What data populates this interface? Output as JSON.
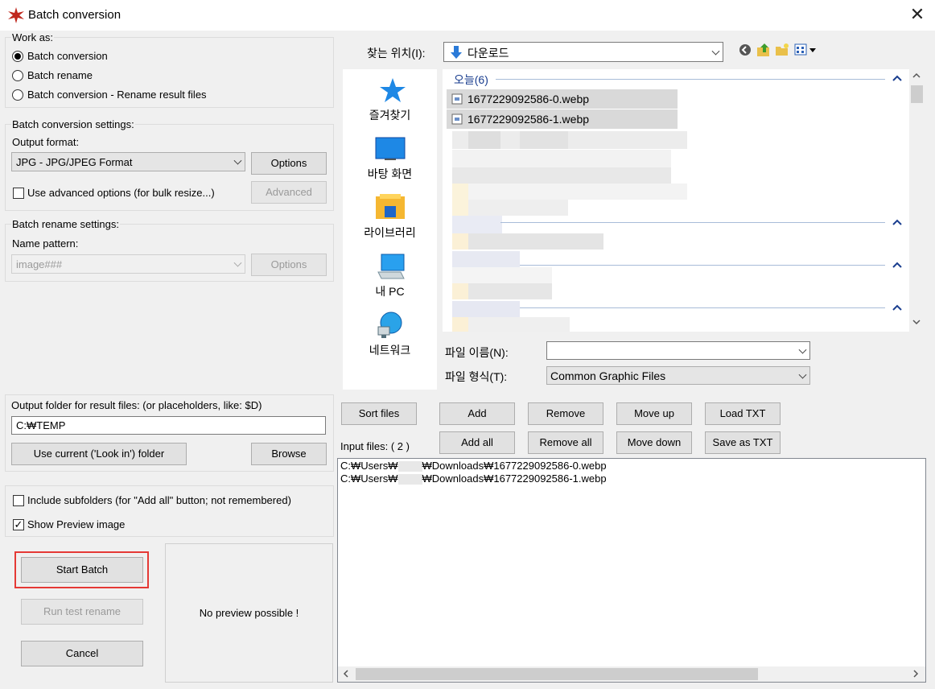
{
  "window": {
    "title": "Batch conversion",
    "close_glyph": "✕"
  },
  "work_as": {
    "label": "Work as:",
    "options": [
      {
        "label": "Batch conversion",
        "selected": true
      },
      {
        "label": "Batch rename",
        "selected": false
      },
      {
        "label": "Batch conversion - Rename result files",
        "selected": false
      }
    ]
  },
  "conversion_settings": {
    "label": "Batch conversion settings:",
    "output_format_label": "Output format:",
    "output_format_value": "JPG - JPG/JPEG Format",
    "options_button": "Options",
    "advanced_checkbox": "Use advanced options (for bulk resize...)",
    "advanced_button": "Advanced"
  },
  "rename_settings": {
    "label": "Batch rename settings:",
    "name_pattern_label": "Name pattern:",
    "name_pattern_value": "image###",
    "options_button": "Options"
  },
  "output_folder": {
    "label": "Output folder for result files: (or placeholders, like: $D)",
    "value": "C:₩TEMP",
    "use_current_button": "Use current ('Look in') folder",
    "browse_button": "Browse"
  },
  "include_subfolders": "Include subfolders (for \"Add all\" button; not remembered)",
  "show_preview": "Show Preview image",
  "start_batch": "Start Batch",
  "run_test_rename": "Run test rename",
  "cancel": "Cancel",
  "preview_text": "No preview possible !",
  "file_dialog": {
    "look_in_label": "찾는 위치(I):",
    "look_in_value": "다운로드",
    "places": [
      {
        "label": "즐겨찾기",
        "icon": "star-icon"
      },
      {
        "label": "바탕 화면",
        "icon": "desktop-icon"
      },
      {
        "label": "라이브러리",
        "icon": "library-icon"
      },
      {
        "label": "내 PC",
        "icon": "pc-icon"
      },
      {
        "label": "네트워크",
        "icon": "network-icon"
      }
    ],
    "group_header": "오늘(6)",
    "files": [
      "1677229092586-0.webp",
      "1677229092586-1.webp"
    ],
    "filename_label": "파일 이름(N):",
    "filename_value": "",
    "filetype_label": "파일 형식(T):",
    "filetype_value": "Common Graphic Files"
  },
  "file_buttons": {
    "sort_files": "Sort files",
    "add": "Add",
    "remove": "Remove",
    "move_up": "Move up",
    "load_txt": "Load TXT",
    "add_all": "Add all",
    "remove_all": "Remove all",
    "move_down": "Move down",
    "save_txt": "Save as TXT"
  },
  "input_files": {
    "label": "Input files:  ( 2 )",
    "rows": [
      {
        "prefix": "C:₩Users₩",
        "suffix": "₩Downloads₩1677229092586-0.webp"
      },
      {
        "prefix": "C:₩Users₩",
        "suffix": "₩Downloads₩1677229092586-1.webp"
      }
    ]
  }
}
